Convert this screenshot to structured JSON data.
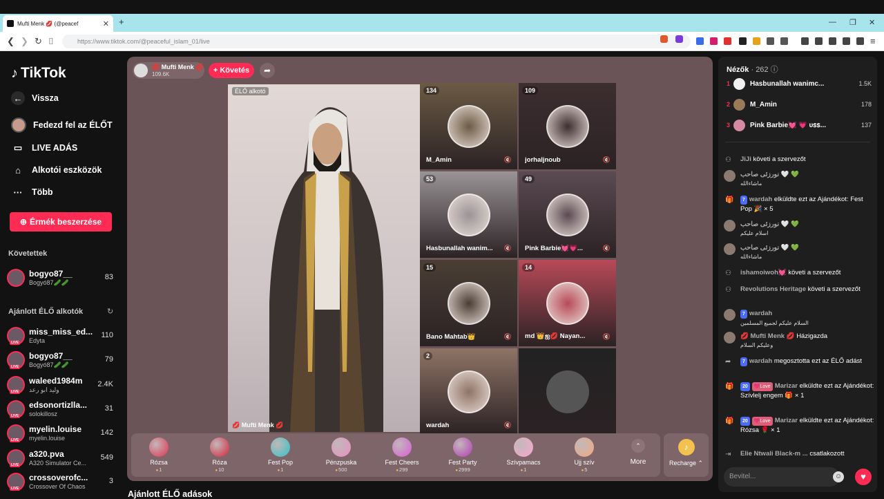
{
  "browser": {
    "tab_title": "Mufti Menk 💋 (@peacef",
    "url": "https://www.tiktok.com/@peaceful_islam_01/live"
  },
  "sidebar": {
    "logo": "TikTok",
    "nav": [
      {
        "label": "Vissza",
        "icon": "back-arrow-icon"
      },
      {
        "label": "Fedezd fel az ÉLŐT",
        "icon": "avatar"
      },
      {
        "label": "LIVE ADÁS",
        "icon": "camera-icon"
      },
      {
        "label": "Alkotói eszközök",
        "icon": "house-icon"
      },
      {
        "label": "Több",
        "icon": "more-icon"
      }
    ],
    "coins_button": "Érmék beszerzése",
    "following_header": "Követettek",
    "following": [
      {
        "name": "bogyo87__",
        "desc": "Bogyó87🥒🥒",
        "count": "83"
      }
    ],
    "recommended_header": "Ajánlott ÉLŐ alkotók",
    "recommended": [
      {
        "name": "miss_miss_ed...",
        "desc": "Edyta",
        "count": "110"
      },
      {
        "name": "bogyo87__",
        "desc": "Bogyó87🥒🥒",
        "count": "79"
      },
      {
        "name": "waleed1984m",
        "desc": "وليد ابو رعد",
        "count": "2.4K"
      },
      {
        "name": "edsonortizlla...",
        "desc": "solokillosz",
        "count": "31"
      },
      {
        "name": "myelin.louise",
        "desc": "myelin.louise",
        "count": "142"
      },
      {
        "name": "a320.pva",
        "desc": "A320 Simulator Ce...",
        "count": "549"
      },
      {
        "name": "crossoverofc...",
        "desc": "Crossover Of Chaos",
        "count": "3"
      }
    ]
  },
  "stage": {
    "host_name": "💋 Mufti Menk 💋",
    "host_count": "109.6K",
    "follow_button": "+ Követés",
    "main_label": "ÉLŐ alkotó",
    "main_name": "💋 Mufti Menk 💋",
    "guests": [
      {
        "name": "M_Amin",
        "count": "134",
        "color": "#6b5a44"
      },
      {
        "name": "jorhaljnoub",
        "count": "109",
        "color": "#3d2e30"
      },
      {
        "name": "Hasbunallah wanim...",
        "count": "53",
        "color": "#9a9496"
      },
      {
        "name": "Pink Barbie💓💗...",
        "count": "49",
        "color": "#5b4a52"
      },
      {
        "name": "Bano Mahtab👑",
        "count": "15",
        "color": "#4a3e34"
      },
      {
        "name": "md 👑ஐ💋 Nayan...",
        "count": "14",
        "color": "#b84a58"
      },
      {
        "name": "wardah",
        "count": "2",
        "color": "#8f7466"
      },
      {
        "name": "",
        "count": "",
        "color": "#222222"
      }
    ],
    "gifts": [
      {
        "name": "Rózsa",
        "price": "1",
        "color": "#e0334f"
      },
      {
        "name": "Róza",
        "price": "10",
        "color": "#d6243b"
      },
      {
        "name": "Fest Pop",
        "price": "1",
        "color": "#2ec4c4"
      },
      {
        "name": "Pénzpuska",
        "price": "500",
        "color": "#e891c0"
      },
      {
        "name": "Fest Cheers",
        "price": "299",
        "color": "#d85dd8"
      },
      {
        "name": "Fest Party",
        "price": "2999",
        "color": "#b53cb8"
      },
      {
        "name": "Szívpamacs",
        "price": "1",
        "color": "#f7a8cf"
      },
      {
        "name": "Ujj szív",
        "price": "5",
        "color": "#f1a97f"
      }
    ],
    "more_label": "More",
    "recharge_label": "Recharge ⌃"
  },
  "below_title": "Ajánlott ÉLŐ adások",
  "viewers": {
    "title": "Nézők",
    "count": "· 262",
    "top": [
      {
        "rank": "1",
        "name": "Hasbunallah wanimc...",
        "count": "1.5K",
        "color": "#f0f0f0"
      },
      {
        "rank": "2",
        "name": "M_Amin",
        "count": "178",
        "color": "#9a7a5a"
      },
      {
        "rank": "3",
        "name": "Pink Barbie💓 💗 ᴜꜱꜱ...",
        "count": "137",
        "color": "#d48aa0"
      }
    ]
  },
  "chat": [
    {
      "icon": "follow-icon",
      "name": "JiJi",
      "text": "követi a szervezőt",
      "badge": "",
      "arabic": ""
    },
    {
      "icon": "avatar",
      "name": "نورزئی صاحب 🤍 💚",
      "text": "",
      "badge": "",
      "arabic": "ماشاءالله"
    },
    {
      "icon": "gift-icon",
      "name": "wardah",
      "text": "elküldte ezt az Ajándékot: Fest Pop 🎉 × 5",
      "badge": "7",
      "arabic": ""
    },
    {
      "icon": "avatar",
      "name": "نورزئی صاحب 🤍 💚",
      "text": "",
      "badge": "",
      "arabic": "اسلام علیکم"
    },
    {
      "icon": "avatar",
      "name": "نورزئی صاحب 🤍 💚",
      "text": "",
      "badge": "",
      "arabic": "ماشاءالله"
    },
    {
      "icon": "follow-icon",
      "name": "ishamoiwoh💓",
      "text": "követi a szervezőt",
      "badge": "",
      "arabic": ""
    },
    {
      "icon": "follow-icon",
      "name": "Revolutions Heritage",
      "text": "követi a szervezőt",
      "badge": "",
      "arabic": ""
    },
    {
      "icon": "avatar",
      "name": "wardah",
      "text": "",
      "badge": "7",
      "arabic": "السلام عليكم لجميع المسلمين"
    },
    {
      "icon": "avatar",
      "name": "💋 Mufti Menk 💋",
      "text": "Házigazda",
      "badge": "",
      "arabic": "وعليكم السلام"
    },
    {
      "icon": "share-icon",
      "name": "wardah",
      "text": "megosztotta ezt az ÉLŐ adást",
      "badge": "7",
      "arabic": ""
    },
    {
      "icon": "gift-icon",
      "name": "Marizar",
      "text": "elküldte ezt az Ajándékot: Szívlelj engem 🎁 × 1",
      "badge": "20",
      "arabic": ""
    },
    {
      "icon": "gift-icon",
      "name": "Marizar",
      "text": "elküldte ezt az Ajándékot: Rózsa 🌹 × 1",
      "badge": "20",
      "arabic": ""
    },
    {
      "icon": "join-icon",
      "name": "Elie Ntwali Black-m ...",
      "text": "csatlakozott",
      "badge": "",
      "arabic": ""
    }
  ],
  "chat_love": "💗Love",
  "input_placeholder": "Bevitel..."
}
